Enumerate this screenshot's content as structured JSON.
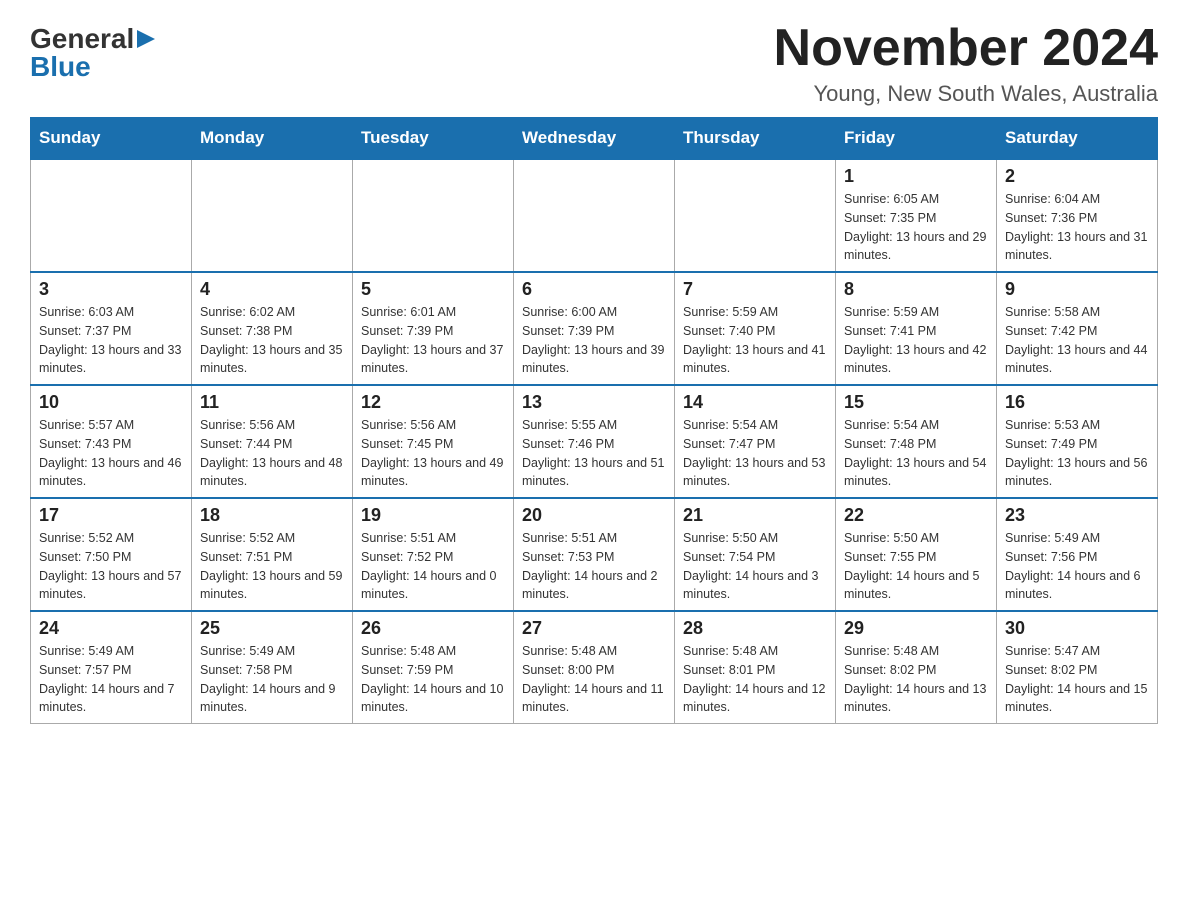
{
  "logo": {
    "general": "General",
    "arrow": "▶",
    "blue": "Blue"
  },
  "title": "November 2024",
  "location": "Young, New South Wales, Australia",
  "days_of_week": [
    "Sunday",
    "Monday",
    "Tuesday",
    "Wednesday",
    "Thursday",
    "Friday",
    "Saturday"
  ],
  "weeks": [
    [
      {
        "day": "",
        "info": ""
      },
      {
        "day": "",
        "info": ""
      },
      {
        "day": "",
        "info": ""
      },
      {
        "day": "",
        "info": ""
      },
      {
        "day": "",
        "info": ""
      },
      {
        "day": "1",
        "info": "Sunrise: 6:05 AM\nSunset: 7:35 PM\nDaylight: 13 hours and 29 minutes."
      },
      {
        "day": "2",
        "info": "Sunrise: 6:04 AM\nSunset: 7:36 PM\nDaylight: 13 hours and 31 minutes."
      }
    ],
    [
      {
        "day": "3",
        "info": "Sunrise: 6:03 AM\nSunset: 7:37 PM\nDaylight: 13 hours and 33 minutes."
      },
      {
        "day": "4",
        "info": "Sunrise: 6:02 AM\nSunset: 7:38 PM\nDaylight: 13 hours and 35 minutes."
      },
      {
        "day": "5",
        "info": "Sunrise: 6:01 AM\nSunset: 7:39 PM\nDaylight: 13 hours and 37 minutes."
      },
      {
        "day": "6",
        "info": "Sunrise: 6:00 AM\nSunset: 7:39 PM\nDaylight: 13 hours and 39 minutes."
      },
      {
        "day": "7",
        "info": "Sunrise: 5:59 AM\nSunset: 7:40 PM\nDaylight: 13 hours and 41 minutes."
      },
      {
        "day": "8",
        "info": "Sunrise: 5:59 AM\nSunset: 7:41 PM\nDaylight: 13 hours and 42 minutes."
      },
      {
        "day": "9",
        "info": "Sunrise: 5:58 AM\nSunset: 7:42 PM\nDaylight: 13 hours and 44 minutes."
      }
    ],
    [
      {
        "day": "10",
        "info": "Sunrise: 5:57 AM\nSunset: 7:43 PM\nDaylight: 13 hours and 46 minutes."
      },
      {
        "day": "11",
        "info": "Sunrise: 5:56 AM\nSunset: 7:44 PM\nDaylight: 13 hours and 48 minutes."
      },
      {
        "day": "12",
        "info": "Sunrise: 5:56 AM\nSunset: 7:45 PM\nDaylight: 13 hours and 49 minutes."
      },
      {
        "day": "13",
        "info": "Sunrise: 5:55 AM\nSunset: 7:46 PM\nDaylight: 13 hours and 51 minutes."
      },
      {
        "day": "14",
        "info": "Sunrise: 5:54 AM\nSunset: 7:47 PM\nDaylight: 13 hours and 53 minutes."
      },
      {
        "day": "15",
        "info": "Sunrise: 5:54 AM\nSunset: 7:48 PM\nDaylight: 13 hours and 54 minutes."
      },
      {
        "day": "16",
        "info": "Sunrise: 5:53 AM\nSunset: 7:49 PM\nDaylight: 13 hours and 56 minutes."
      }
    ],
    [
      {
        "day": "17",
        "info": "Sunrise: 5:52 AM\nSunset: 7:50 PM\nDaylight: 13 hours and 57 minutes."
      },
      {
        "day": "18",
        "info": "Sunrise: 5:52 AM\nSunset: 7:51 PM\nDaylight: 13 hours and 59 minutes."
      },
      {
        "day": "19",
        "info": "Sunrise: 5:51 AM\nSunset: 7:52 PM\nDaylight: 14 hours and 0 minutes."
      },
      {
        "day": "20",
        "info": "Sunrise: 5:51 AM\nSunset: 7:53 PM\nDaylight: 14 hours and 2 minutes."
      },
      {
        "day": "21",
        "info": "Sunrise: 5:50 AM\nSunset: 7:54 PM\nDaylight: 14 hours and 3 minutes."
      },
      {
        "day": "22",
        "info": "Sunrise: 5:50 AM\nSunset: 7:55 PM\nDaylight: 14 hours and 5 minutes."
      },
      {
        "day": "23",
        "info": "Sunrise: 5:49 AM\nSunset: 7:56 PM\nDaylight: 14 hours and 6 minutes."
      }
    ],
    [
      {
        "day": "24",
        "info": "Sunrise: 5:49 AM\nSunset: 7:57 PM\nDaylight: 14 hours and 7 minutes."
      },
      {
        "day": "25",
        "info": "Sunrise: 5:49 AM\nSunset: 7:58 PM\nDaylight: 14 hours and 9 minutes."
      },
      {
        "day": "26",
        "info": "Sunrise: 5:48 AM\nSunset: 7:59 PM\nDaylight: 14 hours and 10 minutes."
      },
      {
        "day": "27",
        "info": "Sunrise: 5:48 AM\nSunset: 8:00 PM\nDaylight: 14 hours and 11 minutes."
      },
      {
        "day": "28",
        "info": "Sunrise: 5:48 AM\nSunset: 8:01 PM\nDaylight: 14 hours and 12 minutes."
      },
      {
        "day": "29",
        "info": "Sunrise: 5:48 AM\nSunset: 8:02 PM\nDaylight: 14 hours and 13 minutes."
      },
      {
        "day": "30",
        "info": "Sunrise: 5:47 AM\nSunset: 8:02 PM\nDaylight: 14 hours and 15 minutes."
      }
    ]
  ]
}
